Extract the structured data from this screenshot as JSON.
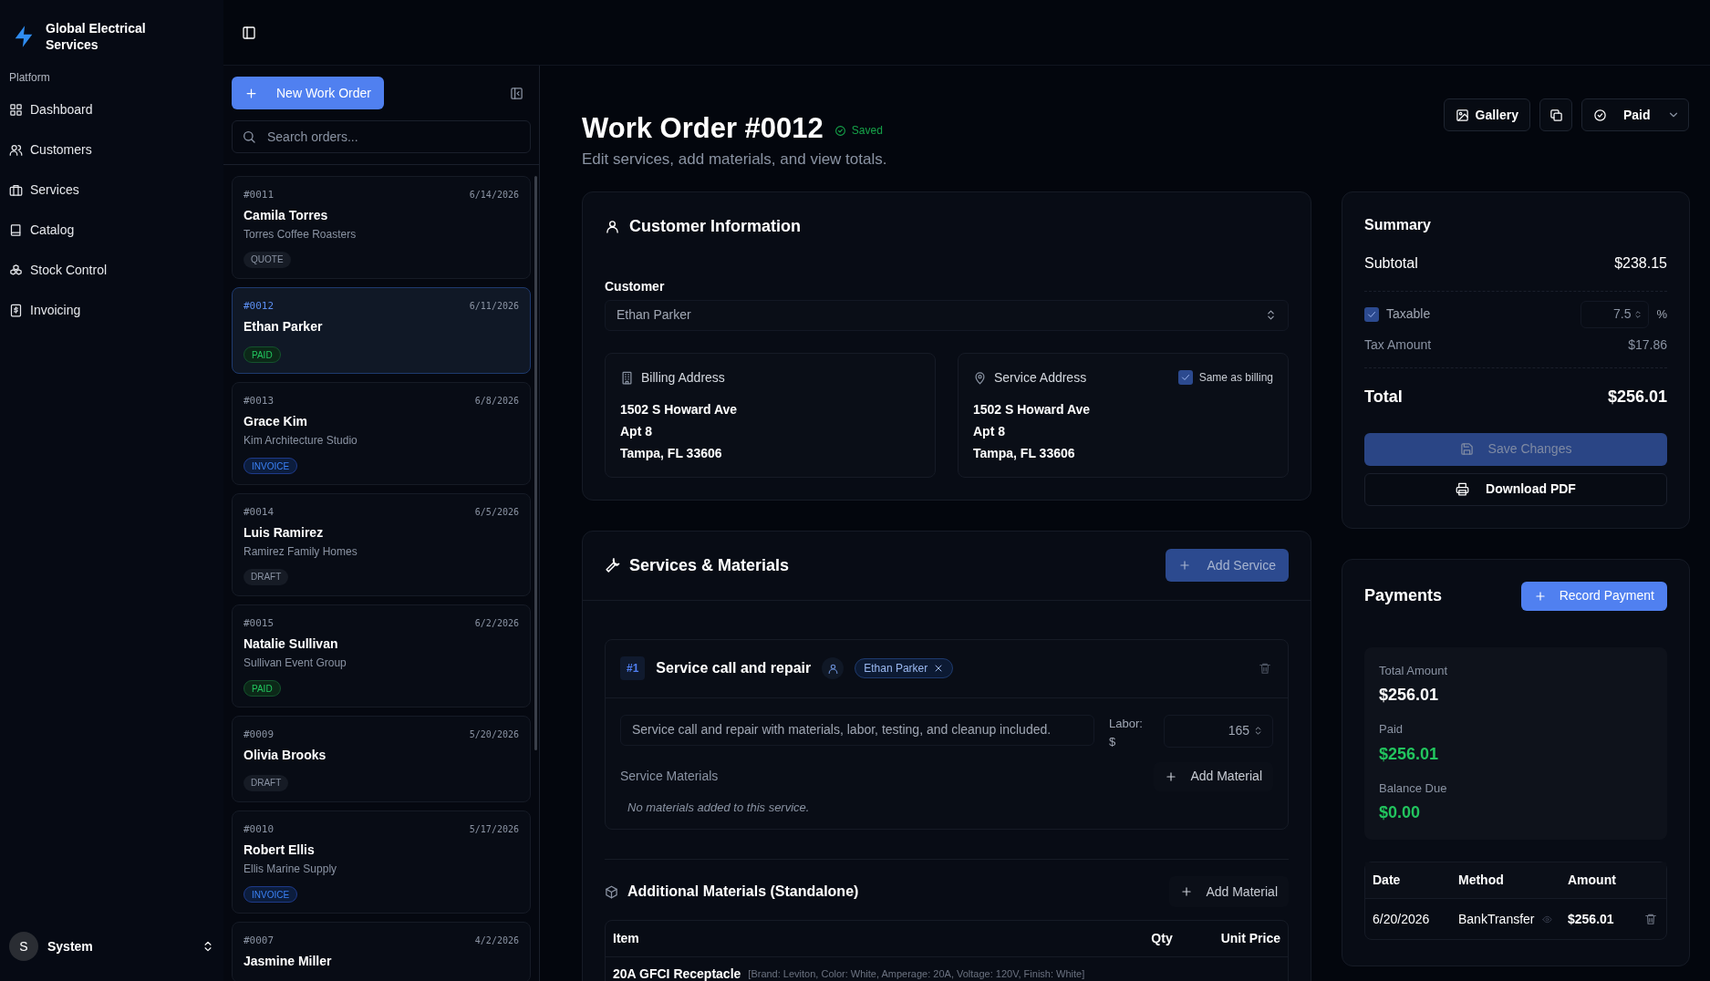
{
  "app": {
    "name": "Global Electrical Services"
  },
  "sidebar": {
    "section": "Platform",
    "items": [
      {
        "label": "Dashboard"
      },
      {
        "label": "Customers"
      },
      {
        "label": "Services"
      },
      {
        "label": "Catalog"
      },
      {
        "label": "Stock Control"
      },
      {
        "label": "Invoicing"
      }
    ]
  },
  "user": {
    "initial": "S",
    "name": "System"
  },
  "orders_panel": {
    "new_button": "New Work Order",
    "search": {
      "placeholder": "Search orders..."
    },
    "orders": [
      {
        "number": "#0011",
        "date": "6/14/2026",
        "name": "Camila Torres",
        "company": "Torres Coffee Roasters",
        "status": {
          "label": "QUOTE",
          "kind": "quote"
        },
        "selected": false
      },
      {
        "number": "#0012",
        "date": "6/11/2026",
        "name": "Ethan Parker",
        "status": {
          "label": "PAID",
          "kind": "paid"
        },
        "selected": true
      },
      {
        "number": "#0013",
        "date": "6/8/2026",
        "name": "Grace Kim",
        "company": "Kim Architecture Studio",
        "status": {
          "label": "INVOICE",
          "kind": "invoice"
        },
        "selected": false
      },
      {
        "number": "#0014",
        "date": "6/5/2026",
        "name": "Luis Ramirez",
        "company": "Ramirez Family Homes",
        "status": {
          "label": "DRAFT",
          "kind": "draft"
        },
        "selected": false
      },
      {
        "number": "#0015",
        "date": "6/2/2026",
        "name": "Natalie Sullivan",
        "company": "Sullivan Event Group",
        "status": {
          "label": "PAID",
          "kind": "paid"
        },
        "selected": false
      },
      {
        "number": "#0009",
        "date": "5/20/2026",
        "name": "Olivia Brooks",
        "status": {
          "label": "DRAFT",
          "kind": "draft"
        },
        "selected": false
      },
      {
        "number": "#0010",
        "date": "5/17/2026",
        "name": "Robert Ellis",
        "company": "Ellis Marine Supply",
        "status": {
          "label": "INVOICE",
          "kind": "invoice"
        },
        "selected": false
      },
      {
        "number": "#0007",
        "date": "4/2/2026",
        "name": "Jasmine Miller",
        "selected": false
      }
    ]
  },
  "header": {
    "title": "Work Order #0012",
    "saved": "Saved",
    "subtitle": "Edit services, add materials, and view totals.",
    "gallery_button": "Gallery",
    "status_select": "Paid"
  },
  "customer_info": {
    "heading": "Customer Information",
    "field_label": "Customer",
    "customer": "Ethan Parker",
    "billing": {
      "title": "Billing Address",
      "lines": [
        "1502 S Howard Ave",
        "Apt 8",
        "Tampa, FL 33606"
      ]
    },
    "service": {
      "title": "Service Address",
      "same_as_billing": {
        "label": "Same as billing",
        "checked": true
      },
      "lines": [
        "1502 S Howard Ave",
        "Apt 8",
        "Tampa, FL 33606"
      ]
    }
  },
  "services": {
    "heading": "Services & Materials",
    "add_button": "Add Service",
    "items": [
      {
        "index": "#1",
        "name": "Service call and repair",
        "assignee": "Ethan Parker",
        "description": "Service call and repair with materials, labor, testing, and cleanup included.",
        "labor_label": "Labor: $",
        "labor": "165",
        "materials_label": "Service Materials",
        "add_material": "Add Material",
        "empty": "No materials added to this service."
      }
    ]
  },
  "additional_materials": {
    "heading": "Additional Materials (Standalone)",
    "add_button": "Add Material",
    "columns": [
      "Item",
      "Qty",
      "Unit Price"
    ],
    "rows": [
      {
        "item": "20A GFCI Receptacle",
        "attributes": "[Brand: Leviton, Color: White, Amperage: 20A, Voltage: 120V, Finish: White]"
      }
    ]
  },
  "summary": {
    "title": "Summary",
    "subtotal_label": "Subtotal",
    "subtotal": "$238.15",
    "taxable": {
      "label": "Taxable",
      "checked": true,
      "rate": "7.5",
      "unit": "%"
    },
    "tax_label": "Tax Amount",
    "tax": "$17.86",
    "total_label": "Total",
    "total": "$256.01",
    "save_button": {
      "label": "Save Changes",
      "disabled": true
    },
    "download_button": "Download PDF"
  },
  "payments": {
    "title": "Payments",
    "record_button": "Record Payment",
    "totals": [
      {
        "label": "Total Amount",
        "value": "$256.01",
        "kind": "neutral"
      },
      {
        "label": "Paid",
        "value": "$256.01",
        "kind": "positive"
      },
      {
        "label": "Balance Due",
        "value": "$0.00",
        "kind": "positive"
      }
    ],
    "columns": [
      "Date",
      "Method",
      "Amount"
    ],
    "rows": [
      {
        "date": "6/20/2026",
        "method": "BankTransfer",
        "amount": "$256.01"
      }
    ]
  }
}
